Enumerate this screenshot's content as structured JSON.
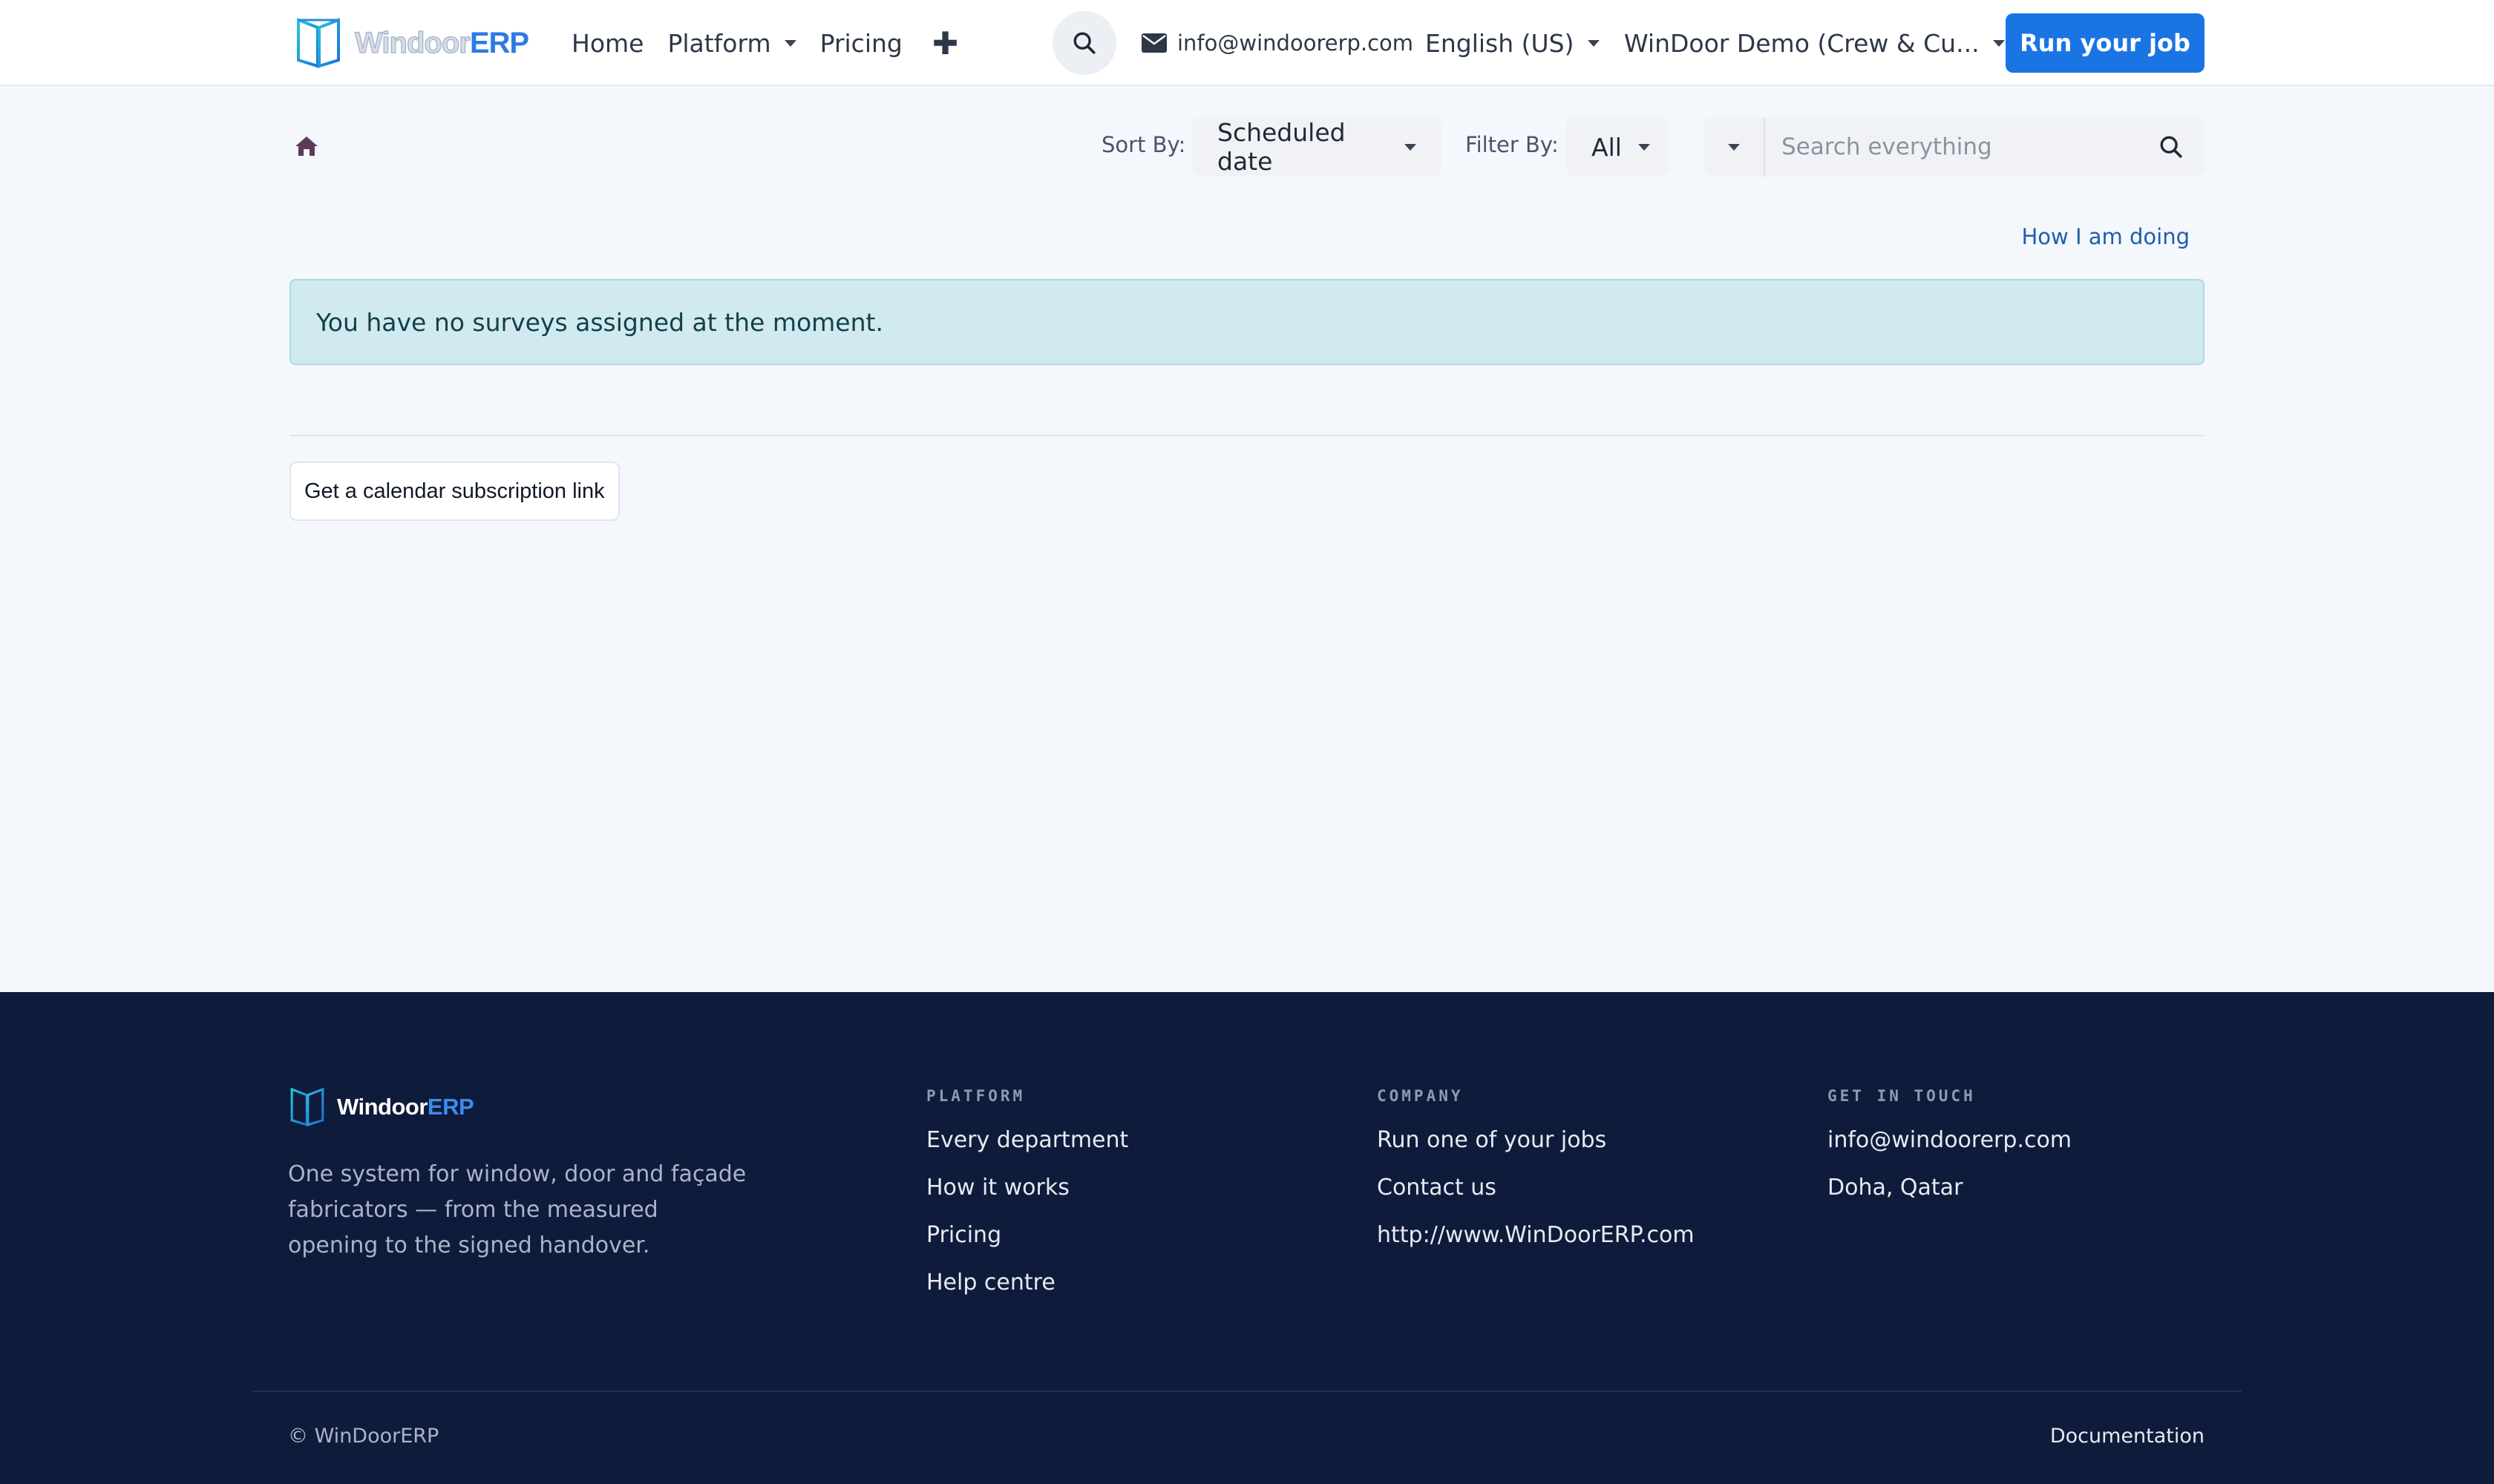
{
  "header": {
    "logo_part1": "Windoor",
    "logo_part2": "ERP",
    "nav": {
      "home": "Home",
      "platform": "Platform",
      "pricing": "Pricing"
    },
    "email": "info@windoorerp.com",
    "language": "English (US)",
    "company": "WinDoor Demo (Crew & Cu...",
    "cta": "Run your job"
  },
  "toolbar": {
    "sort_label": "Sort By:",
    "sort_value": "Scheduled date",
    "filter_label": "Filter By:",
    "filter_value": "All",
    "search_placeholder": "Search everything"
  },
  "main": {
    "how_link": "How I am doing",
    "alert": "You have no surveys assigned at the moment.",
    "calendar_button": "Get a calendar subscription link"
  },
  "footer": {
    "logo_part1": "Windoor",
    "logo_part2": "ERP",
    "tagline": "One system for window, door and façade fabricators — from the measured opening to the signed handover.",
    "platform": {
      "heading": "PLATFORM",
      "links": [
        "Every department",
        "How it works",
        "Pricing",
        "Help centre"
      ]
    },
    "company": {
      "heading": "COMPANY",
      "links": [
        "Run one of your jobs",
        "Contact us",
        "http://www.WinDoorERP.com"
      ]
    },
    "contact": {
      "heading": "GET IN TOUCH",
      "links": [
        "info@windoorerp.com",
        "Doha, Qatar"
      ]
    },
    "copyright": "© WinDoorERP",
    "documentation": "Documentation"
  },
  "colors": {
    "accent": "#1b74e4",
    "footer_bg": "#0f1b3a",
    "alert_bg": "#d1eaef",
    "page_bg": "#f4f7fc"
  }
}
